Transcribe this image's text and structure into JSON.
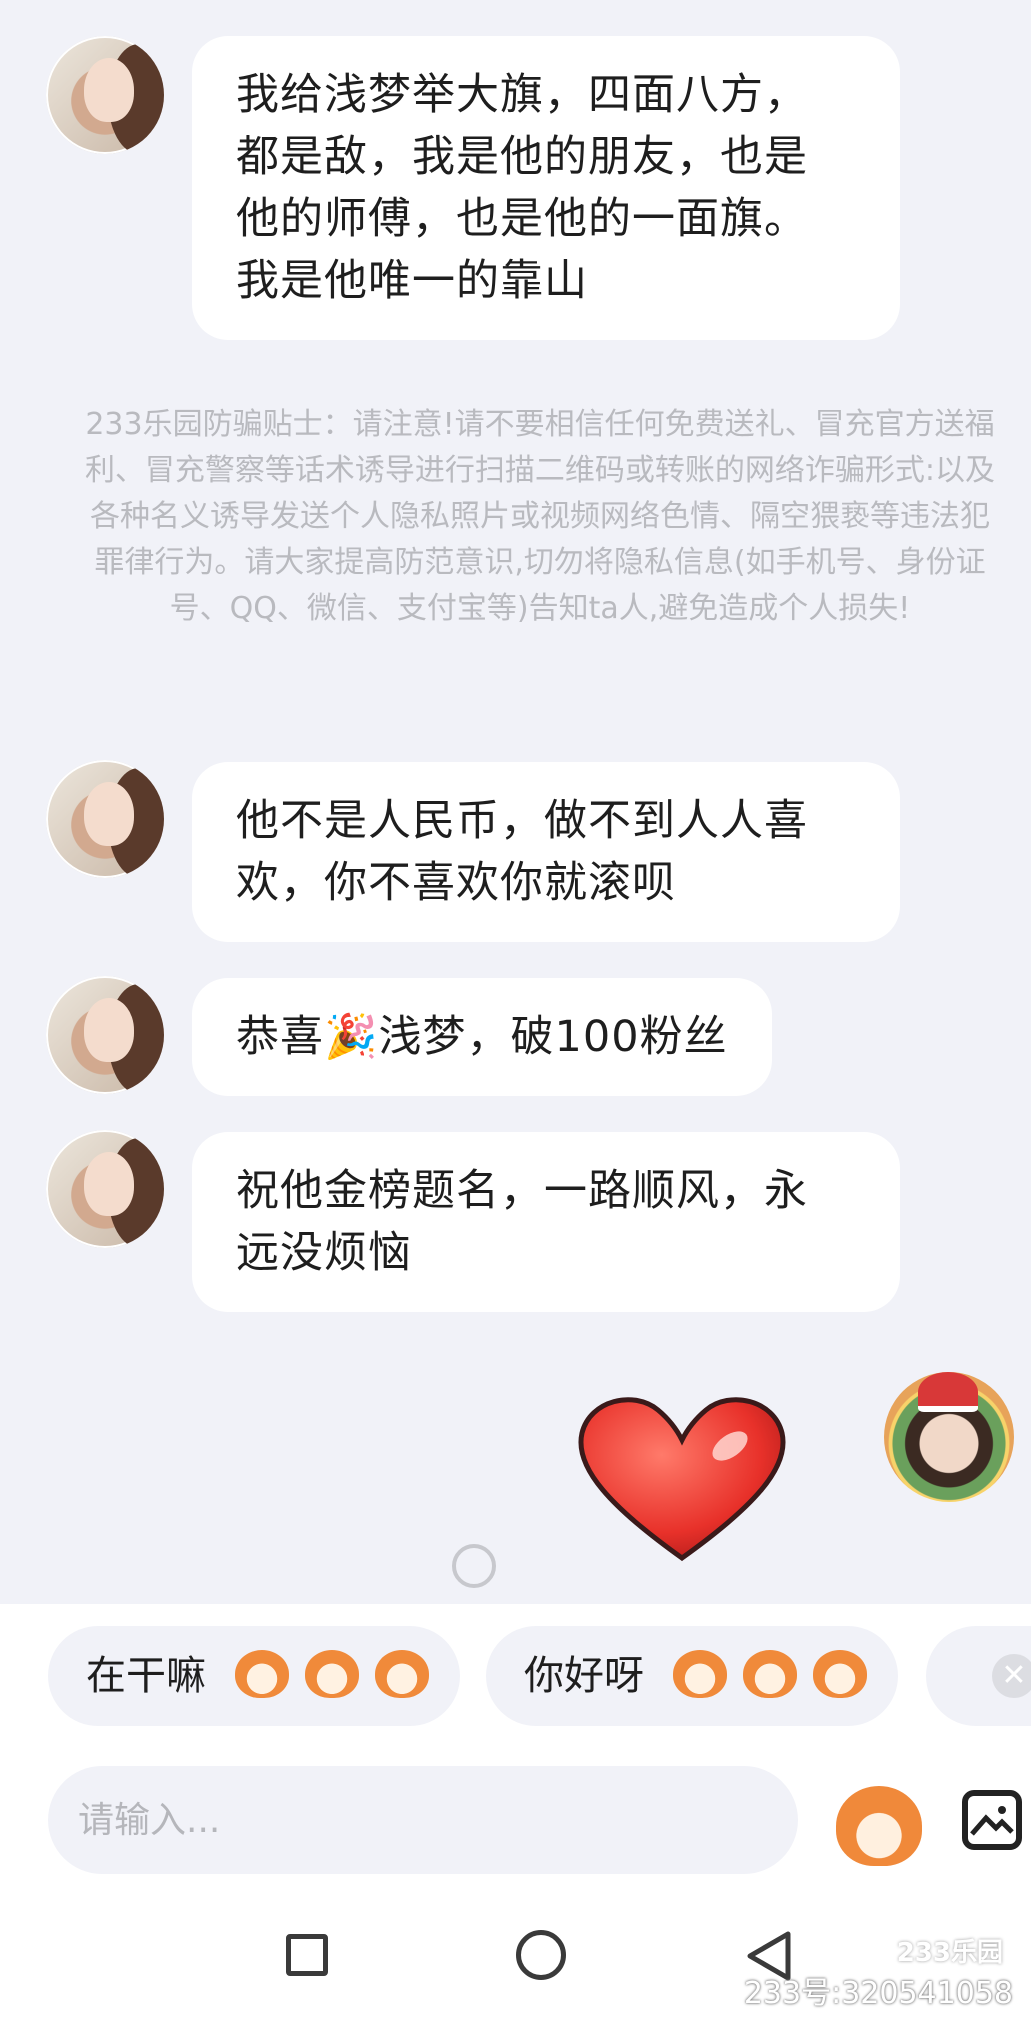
{
  "messages": [
    {
      "text": "我给浅梦举大旗，四面八方，\n都是敌，我是他的朋友，也是\n他的师傅，也是他的一面旗。\n我是他唯一的靠山"
    },
    {
      "text": "他不是人民币，做不到人人喜\n欢，你不喜欢你就滚呗"
    },
    {
      "text": "恭喜🎉浅梦，破100粉丝"
    },
    {
      "text": "祝他金榜题名，一路顺风，永\n远没烦恼"
    }
  ],
  "notice": "233乐园防骗贴士：请注意!请不要相信任何免费送礼、冒充官方送福利、冒充警察等话术诱导进行扫描二维码或转账的网络诈骗形式:以及各种名义诱导发送个人隐私照片或视频网络色情、隔空猥亵等违法犯罪律行为。请大家提高防范意识,切勿将隐私信息(如手机号、身份证号、QQ、微信、支付宝等)告知ta人,避免造成个人损失!",
  "quick_replies": [
    {
      "text": "在干嘛"
    },
    {
      "text": "你好呀"
    }
  ],
  "input": {
    "placeholder": "请输入..."
  },
  "watermark": {
    "logo": "233乐园",
    "id_text": "233号:320541058"
  }
}
